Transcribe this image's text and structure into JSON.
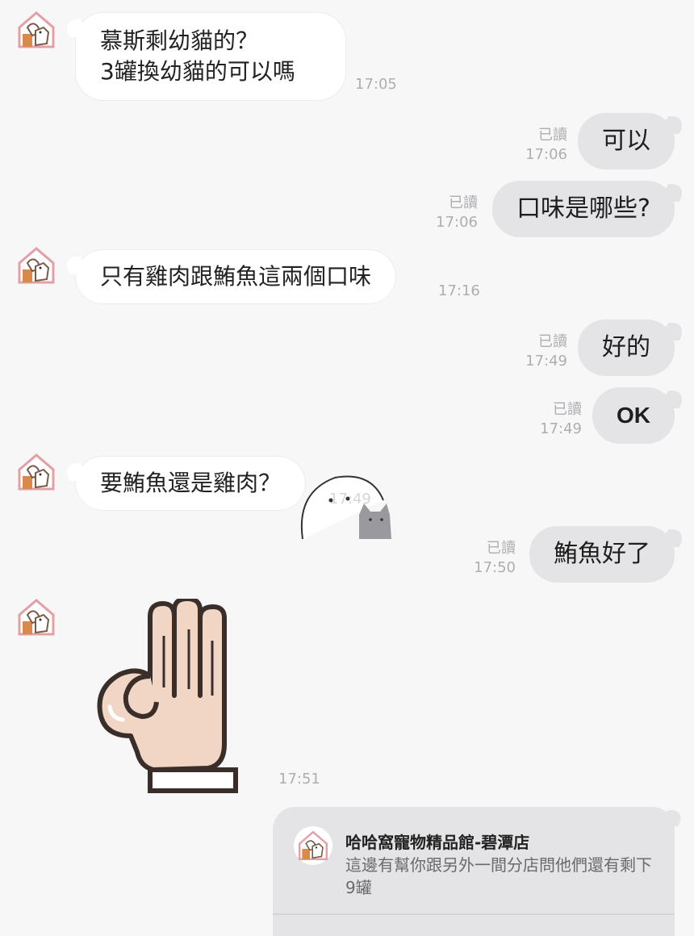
{
  "avatar_name": "cat-dog-house-avatar",
  "messages": [
    {
      "text1": "慕斯剩幼貓的？",
      "text2": "3罐換幼貓的可以嗎",
      "time": "17:05"
    },
    {
      "text": "可以",
      "read": "已讀",
      "time": "17:06"
    },
    {
      "text": "口味是哪些?",
      "read": "已讀",
      "time": "17:06"
    },
    {
      "text": "只有雞肉跟鮪魚這兩個口味",
      "time": "17:16"
    },
    {
      "text": "好的",
      "read": "已讀",
      "time": "17:49"
    },
    {
      "text": "OK",
      "read": "已讀",
      "time": "17:49"
    },
    {
      "text": "要鮪魚還是雞肉？",
      "time": "17:49"
    },
    {
      "text": "鮪魚好了",
      "read": "已讀",
      "time": "17:50"
    },
    {
      "sticker": "ok-hand-sticker",
      "time": "17:51"
    }
  ],
  "share": {
    "title": "哈哈窩寵物精品館-碧潭店",
    "text": "這邊有幫你跟另外一間分店問他們還有剩下9罐"
  },
  "colors": {
    "incoming_bubble": "#ffffff",
    "outgoing_bubble": "#e4e4e6",
    "background": "#f7f7f8"
  }
}
